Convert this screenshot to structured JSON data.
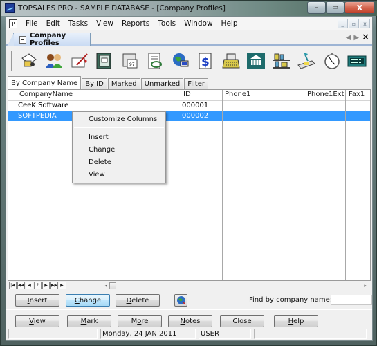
{
  "window": {
    "title": "TOPSALES PRO - SAMPLE DATABASE - [Company Profiles]",
    "controls": {
      "minimize": "–",
      "maximize": "▭",
      "close": "X"
    }
  },
  "menu": {
    "items": [
      "File",
      "Edit",
      "Tasks",
      "View",
      "Reports",
      "Tools",
      "Window",
      "Help"
    ],
    "mdi_controls": {
      "minimize": "_",
      "restore": "▫",
      "close": "x"
    }
  },
  "document_tabs": {
    "active": "Company Profiles",
    "nav": {
      "prev": "◀",
      "next": "▶",
      "close": "✕"
    }
  },
  "toolbar": {
    "buttons": [
      {
        "icon": "contacts-folder-icon"
      },
      {
        "icon": "people-icon"
      },
      {
        "icon": "letter-writing-icon"
      },
      {
        "icon": "address-book-icon"
      },
      {
        "icon": "calendar-icon"
      },
      {
        "icon": "document-search-icon"
      },
      {
        "icon": "globe-computer-icon"
      },
      {
        "icon": "invoice-dollar-icon"
      },
      {
        "icon": "cash-register-icon"
      },
      {
        "icon": "bank-icon"
      },
      {
        "icon": "inventory-shelf-icon"
      },
      {
        "icon": "desk-lamp-icon"
      },
      {
        "icon": "stopwatch-icon"
      },
      {
        "icon": "calculator-icon"
      }
    ]
  },
  "sub_tabs": {
    "items": [
      "By Company Name",
      "By ID",
      "Marked",
      "Unmarked",
      "Filter"
    ],
    "active_index": 0
  },
  "grid": {
    "columns": [
      "CompanyName",
      "ID",
      "Phone1",
      "Phone1Ext",
      "Fax1"
    ],
    "rows": [
      {
        "CompanyName": "CeeK Software",
        "ID": "000001",
        "Phone1": "",
        "Phone1Ext": "",
        "Fax1": "",
        "selected": false
      },
      {
        "CompanyName": "SOFTPEDIA",
        "ID": "000002",
        "Phone1": "",
        "Phone1Ext": "",
        "Fax1": "",
        "selected": true
      }
    ],
    "selection_color": "#3399ff"
  },
  "context_menu": {
    "items": [
      {
        "label": "Customize Columns",
        "separator_after": true
      },
      {
        "label": "Insert"
      },
      {
        "label": "Change"
      },
      {
        "label": "Delete"
      },
      {
        "label": "View"
      }
    ]
  },
  "record_nav": {
    "buttons": [
      "|◀",
      "◀◀",
      "◀",
      "?",
      "▶",
      "▶▶",
      "▶|"
    ],
    "scroll_left": "◂",
    "scroll_right": "▸"
  },
  "actions": {
    "insert": {
      "label": "Insert",
      "accel": "I"
    },
    "change": {
      "label": "Change",
      "accel": "C"
    },
    "delete": {
      "label": "Delete",
      "accel": "D"
    },
    "find_label": "Find by company name:",
    "find_value": ""
  },
  "bottom_buttons": [
    {
      "label": "View",
      "accel": "V"
    },
    {
      "label": "Mark",
      "accel": "M"
    },
    {
      "label": "More",
      "accel": "o"
    },
    {
      "label": "Notes",
      "accel": "N"
    },
    {
      "label": "Close",
      "accel": ""
    },
    {
      "label": "Help",
      "accel": "H"
    }
  ],
  "status_bar": {
    "panel1": "",
    "date": "Monday, 24 JAN 2011",
    "user": "USER",
    "panel4": ""
  }
}
